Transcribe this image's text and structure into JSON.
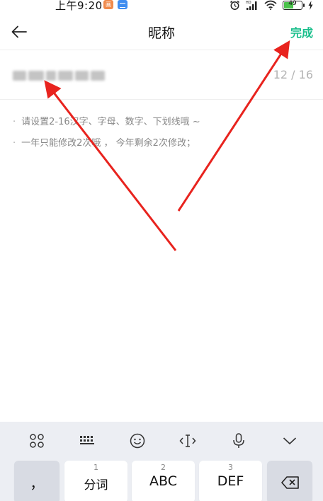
{
  "status_bar": {
    "time": "上午9:20",
    "notif_badge": "画",
    "battery": "49",
    "battery_level": 0.49
  },
  "header": {
    "title": "昵称",
    "done_label": "完成"
  },
  "nickname": {
    "char_count": "12 / 16"
  },
  "tips": [
    "请设置2-16汉字、字母、数字、下划线哦 ~",
    "一年只能修改2次哦 ， 今年剩余2次修改；"
  ],
  "keyboard": {
    "toolbar_icons": [
      "grid-icon",
      "keyboard-icon",
      "emoji-icon",
      "cursor-icon",
      "microphone-icon",
      "collapse-icon"
    ],
    "keys": [
      {
        "number": "",
        "label": "，"
      },
      {
        "number": "1",
        "label": "分词"
      },
      {
        "number": "2",
        "label": "ABC"
      },
      {
        "number": "3",
        "label": "DEF"
      }
    ]
  },
  "colors": {
    "accent": "#1bbf8c",
    "arrow": "#e8231e"
  }
}
